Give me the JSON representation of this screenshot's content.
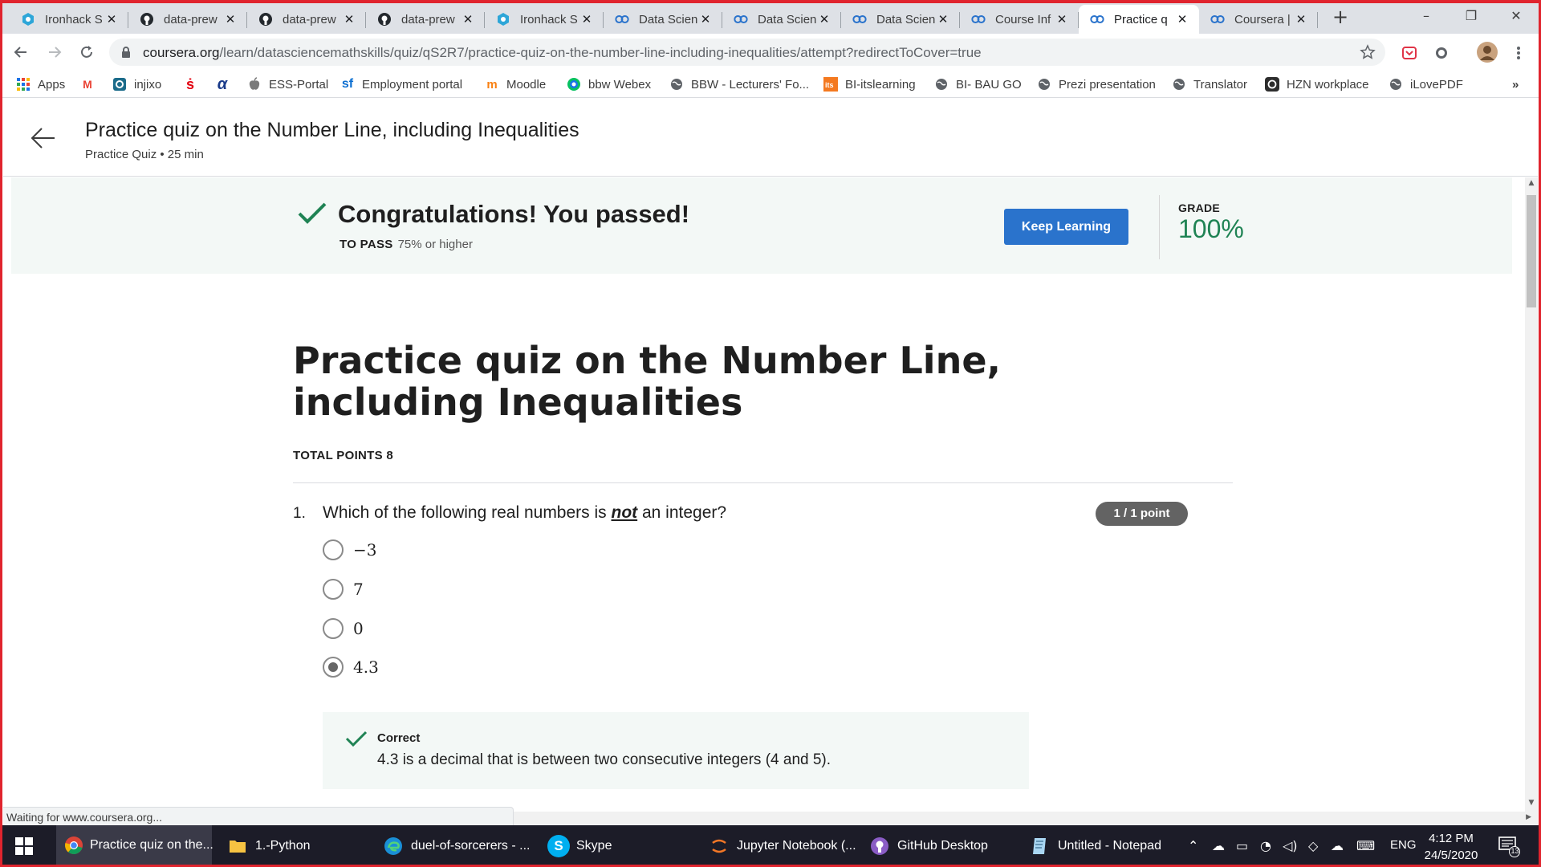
{
  "browser": {
    "tabs": [
      {
        "title": "Ironhack S",
        "icon": "ironhack-icon"
      },
      {
        "title": "data-prew",
        "icon": "github-icon"
      },
      {
        "title": "data-prew",
        "icon": "github-icon"
      },
      {
        "title": "data-prew",
        "icon": "github-icon"
      },
      {
        "title": "Ironhack S",
        "icon": "ironhack-icon"
      },
      {
        "title": "Data Scien",
        "icon": "coursera-icon"
      },
      {
        "title": "Data Scien",
        "icon": "coursera-icon"
      },
      {
        "title": "Data Scien",
        "icon": "coursera-icon"
      },
      {
        "title": "Course Inf",
        "icon": "coursera-icon"
      },
      {
        "title": "Practice q",
        "icon": "coursera-icon",
        "active": true
      },
      {
        "title": "Coursera |",
        "icon": "coursera-icon"
      }
    ],
    "url_host": "coursera.org",
    "url_path": "/learn/datasciencemathskills/quiz/qS2R7/practice-quiz-on-the-number-line-including-inequalities/attempt?redirectToCover=true",
    "bookmarks": [
      {
        "label": "Apps",
        "icon": "apps-grid-icon"
      },
      {
        "label": "",
        "icon": "gmail-icon"
      },
      {
        "label": "injixo",
        "icon": "injixo-icon"
      },
      {
        "label": "",
        "icon": "sparkasse-icon"
      },
      {
        "label": "",
        "icon": "alpha-icon"
      },
      {
        "label": "ESS-Portal",
        "icon": "apple-icon"
      },
      {
        "label": "Employment portal",
        "icon": "sf-icon"
      },
      {
        "label": "Moodle",
        "icon": "moodle-icon"
      },
      {
        "label": "bbw Webex",
        "icon": "webex-icon"
      },
      {
        "label": "BBW - Lecturers' Fo...",
        "icon": "globe-icon"
      },
      {
        "label": "BI-itslearning",
        "icon": "its-icon"
      },
      {
        "label": "BI- BAU GO",
        "icon": "globe-icon"
      },
      {
        "label": "Prezi presentation",
        "icon": "globe-icon"
      },
      {
        "label": "Translator",
        "icon": "globe-icon"
      },
      {
        "label": "HZN workplace",
        "icon": "hzn-icon"
      },
      {
        "label": "iLovePDF",
        "icon": "globe-icon"
      }
    ],
    "bookmarks_overflow": "»",
    "status_text": "Waiting for www.coursera.org..."
  },
  "header": {
    "title": "Practice quiz on the Number Line, including Inequalities",
    "subtitle": "Practice Quiz • 25 min"
  },
  "banner": {
    "title": "Congratulations! You passed!",
    "to_pass_label": "TO PASS",
    "to_pass_value": "75% or higher",
    "keep_learning": "Keep Learning",
    "grade_label": "GRADE",
    "grade_value": "100%"
  },
  "quiz": {
    "title": "Practice quiz on the Number Line, including Inequalities",
    "total_points": "TOTAL POINTS 8",
    "question": {
      "number": "1.",
      "text_before": "Which of the following real numbers is ",
      "text_emph": "not",
      "text_after": " an integer?",
      "points": "1 / 1 point",
      "options": [
        {
          "label": "−3",
          "selected": false
        },
        {
          "label": "7",
          "selected": false
        },
        {
          "label": "0",
          "selected": false
        },
        {
          "label": "4.3",
          "selected": true
        }
      ],
      "feedback": {
        "title": "Correct",
        "text": "4.3 is a decimal that is between two consecutive integers (4 and 5)."
      }
    }
  },
  "taskbar": {
    "items": [
      {
        "label": "Practice quiz on the...",
        "icon": "chrome-icon",
        "active": true
      },
      {
        "label": "1.-Python",
        "icon": "folder-icon"
      },
      {
        "label": "duel-of-sorcerers - ...",
        "icon": "edge-icon"
      },
      {
        "label": "Skype",
        "icon": "skype-icon"
      },
      {
        "label": "Jupyter Notebook (...",
        "icon": "jupyter-icon"
      },
      {
        "label": "GitHub Desktop",
        "icon": "github-desktop-icon"
      },
      {
        "label": "Untitled - Notepad",
        "icon": "notepad-icon"
      }
    ],
    "language": "ENG",
    "time": "4:12 PM",
    "date": "24/5/2020",
    "notification_count": "13"
  },
  "colors": {
    "accent_blue": "#2a73cc",
    "success_green": "#1f8354",
    "banner_bg": "#f3f8f6",
    "window_border": "#e0242e"
  }
}
